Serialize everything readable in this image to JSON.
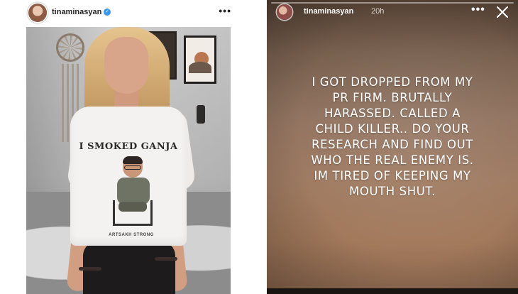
{
  "post": {
    "username": "tinaminasyan",
    "verified_icon": "verified-badge-icon",
    "more_icon": "more-options-icon",
    "more_label": "•••",
    "shirt_text": "I SMOKED GANJA",
    "shirt_bottom_text": "ARTSAKH STRONG"
  },
  "story": {
    "username": "tinaminasyan",
    "time": "20h",
    "more_label": "•••",
    "close_icon": "close-icon",
    "text_lines": [
      "I GOT DROPPED FROM MY",
      "PR FIRM. BRUTALLY",
      "HARASSED. CALLED A",
      "CHILD KILLER.. DO YOUR",
      "RESEARCH AND FIND OUT",
      "WHO THE REAL ENEMY IS.",
      "IM TIRED OF KEEPING MY",
      "MOUTH SHUT."
    ]
  },
  "colors": {
    "verified_blue": "#3897f0",
    "username_text": "#262626",
    "story_text": "#ffffff"
  }
}
